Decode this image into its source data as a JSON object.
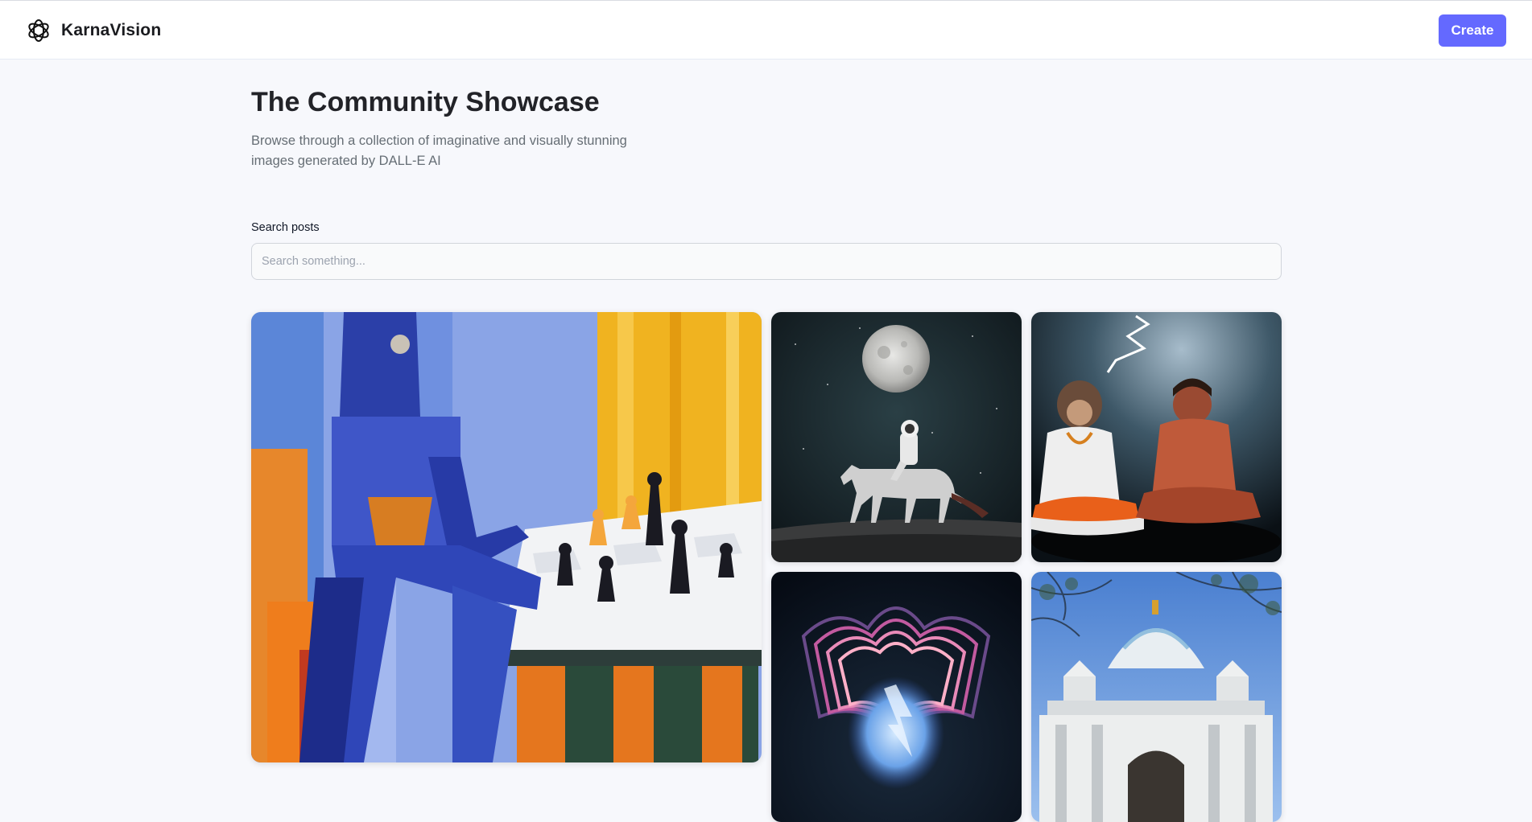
{
  "header": {
    "brand_name": "KarnaVision",
    "logo_icon": "openai-knot-icon",
    "create_label": "Create",
    "accent_color": "#6469ff"
  },
  "hero": {
    "title": "The Community Showcase",
    "subtitle": "Browse through a collection of imaginative and visually stunning images generated by DALL-E AI"
  },
  "search": {
    "label": "Search posts",
    "placeholder": "Search something...",
    "value": ""
  },
  "gallery": {
    "posts": [
      {
        "subject": "robot-playing-chess-painting"
      },
      {
        "subject": "astronaut-riding-horse-moon"
      },
      {
        "subject": "monkey-and-man-meditating"
      },
      {
        "subject": "glowing-lotus-portal"
      },
      {
        "subject": "white-temple-dome"
      }
    ]
  }
}
